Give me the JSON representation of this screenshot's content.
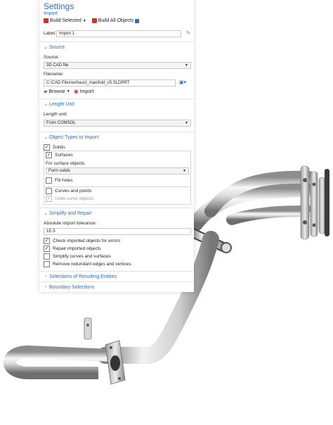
{
  "settings": {
    "title": "Settings",
    "subtitle": "Import",
    "toolbar": {
      "build_selected": "Build Selected",
      "build_all": "Build All Objects"
    },
    "label": {
      "caption": "Label:",
      "value": "Import 1"
    },
    "source_section": {
      "title": "Source",
      "source_caption": "Source:",
      "source_value": "3D CAD file",
      "filename_caption": "Filename:",
      "filename_value": "C:\\CAD Files\\exhaust_manifold_v5.SLDPRT",
      "browse": "Browse",
      "import": "Import"
    },
    "length_unit_section": {
      "title": "Length Unit",
      "caption": "Length unit:",
      "value": "From COMSOL"
    },
    "object_types_section": {
      "title": "Object Types to Import",
      "solids": {
        "label": "Solids",
        "checked": true
      },
      "surfaces": {
        "label": "Surfaces",
        "checked": true
      },
      "surface_objects_caption": "For surface objects:",
      "surface_objects_value": "Form solids",
      "fill_holes": {
        "label": "Fill holes",
        "checked": false
      },
      "curves_points": {
        "label": "Curves and points",
        "checked": false
      },
      "unite_curve": {
        "label": "Unite curve objects",
        "checked": true
      }
    },
    "simplify_section": {
      "title": "Simplify and Repair",
      "tolerance_caption": "Absolute import tolerance:",
      "tolerance_value": "1E-5",
      "check_imported": {
        "label": "Check imported objects for errors",
        "checked": true
      },
      "repair_imported": {
        "label": "Repair imported objects",
        "checked": true
      },
      "simplify_curves": {
        "label": "Simplify curves and surfaces",
        "checked": false
      },
      "remove_redundant": {
        "label": "Remove redundant edges and vertices",
        "checked": false
      }
    },
    "collapsed_sections": {
      "selections": "Selections of Resulting Entities",
      "boundary": "Boundary Selections"
    }
  },
  "colors": {
    "accent": "#2f6db5",
    "build_icon": "#c0392b"
  }
}
